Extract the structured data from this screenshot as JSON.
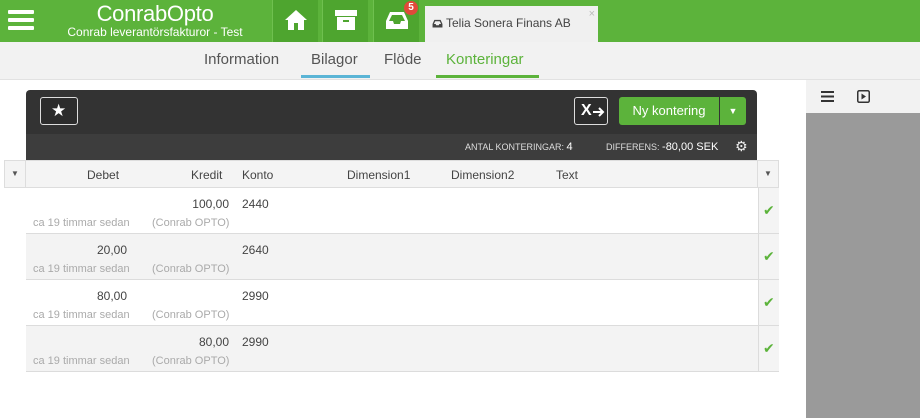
{
  "app": {
    "title": "ConrabOpto",
    "subtitle": "Conrab leverantörsfakturor - Test",
    "brand_color": "#5cb33b"
  },
  "topbar": {
    "icons": [
      "menu-icon",
      "home-icon",
      "archive-icon",
      "inbox-icon"
    ],
    "inbox_badge": "5",
    "doc_tab": {
      "label": "Telia Sonera Finans AB",
      "close": "×"
    }
  },
  "nav": {
    "tabs": [
      {
        "label": "Information"
      },
      {
        "label": "Bilagor"
      },
      {
        "label": "Flöde"
      },
      {
        "label": "Konteringar"
      }
    ],
    "active": "Konteringar"
  },
  "toolbar": {
    "new_label": "Ny kontering",
    "excel_label": "X"
  },
  "status": {
    "count_label": "Antal konteringar:",
    "count_value": "4",
    "diff_label": "Differens:",
    "diff_value": "-80,00 SEK"
  },
  "table": {
    "columns": {
      "debet": "Debet",
      "kredit": "Kredit",
      "konto": "Konto",
      "dim1": "Dimension1",
      "dim2": "Dimension2",
      "text": "Text"
    },
    "rows": [
      {
        "debet": "",
        "kredit": "100,00",
        "konto": "2440",
        "time": "ca 19 timmar sedan",
        "by": "(Conrab OPTO)"
      },
      {
        "debet": "20,00",
        "kredit": "",
        "konto": "2640",
        "time": "ca 19 timmar sedan",
        "by": "(Conrab OPTO)"
      },
      {
        "debet": "80,00",
        "kredit": "",
        "konto": "2990",
        "time": "ca 19 timmar sedan",
        "by": "(Conrab OPTO)"
      },
      {
        "debet": "",
        "kredit": "80,00",
        "konto": "2990",
        "time": "ca 19 timmar sedan",
        "by": "(Conrab OPTO)"
      }
    ]
  },
  "right_panel": {
    "icons": [
      "list-icon",
      "play-icon"
    ]
  }
}
